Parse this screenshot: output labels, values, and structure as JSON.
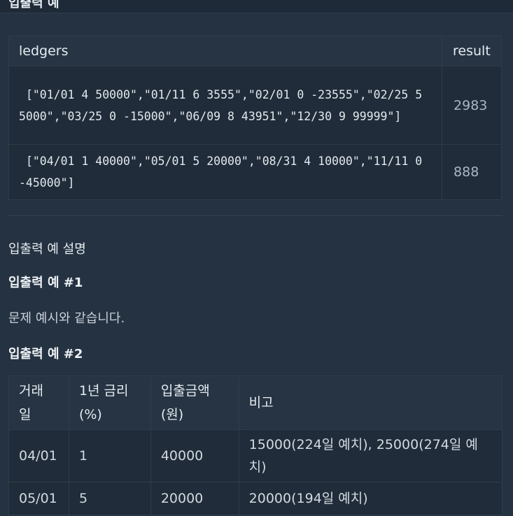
{
  "top_heading": "입출력 예",
  "io_table": {
    "headers": [
      "ledgers",
      "result"
    ],
    "rows": [
      {
        "ledgers": " [\"01/01 4 50000\",\"01/11 6 3555\",\"02/01 0 -23555\",\"02/25 5 5000\",\"03/25 0 -15000\",\"06/09 8 43951\",\"12/30 9 99999\"]",
        "result": "2983"
      },
      {
        "ledgers": " [\"04/01 1 40000\",\"05/01 5 20000\",\"08/31 4 10000\",\"11/11 0 -45000\"]",
        "result": "888"
      }
    ]
  },
  "explanation_title": "입출력 예 설명",
  "example1_heading": "입출력 예 #1",
  "example1_text": "문제 예시와 같습니다.",
  "example2_heading": "입출력 예 #2",
  "info_table": {
    "headers": [
      "거래일",
      "1년 금리(%)",
      "입출금액(원)",
      "비고"
    ],
    "rows": [
      [
        "04/01",
        "1",
        "40000",
        "15000(224일 예치), 25000(274일 예치)"
      ],
      [
        "05/01",
        "5",
        "20000",
        "20000(194일 예치)"
      ]
    ]
  }
}
